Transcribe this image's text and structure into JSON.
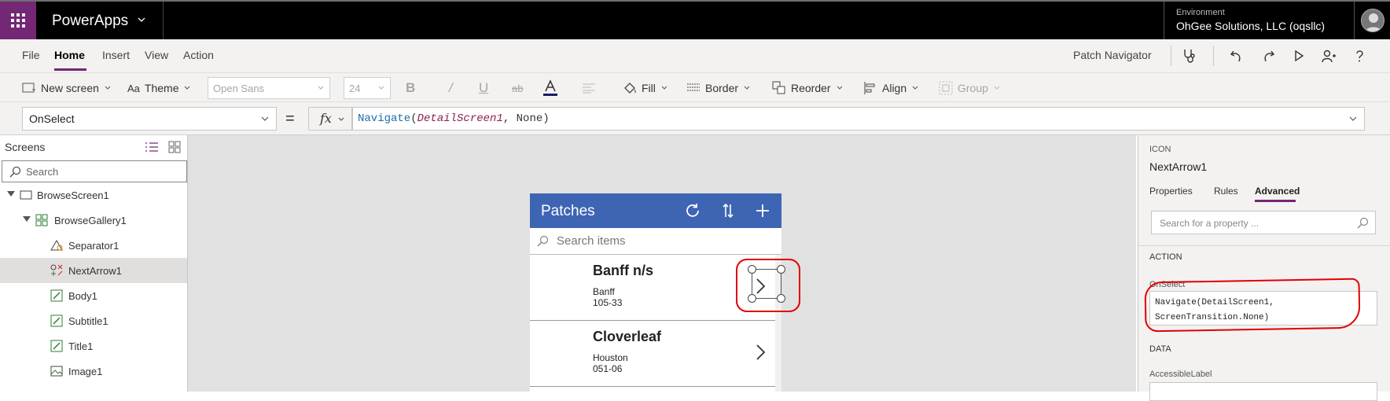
{
  "topbar": {
    "app_name": "PowerApps",
    "environment_label": "Environment",
    "environment_value": "OhGee Solutions, LLC (oqsllc)"
  },
  "menu": {
    "tabs": [
      "File",
      "Home",
      "Insert",
      "View",
      "Action"
    ],
    "active_tab": "Home",
    "screen_name": "Patch Navigator"
  },
  "ribbon": {
    "new_screen": "New screen",
    "theme": "Theme",
    "font_family": "Open Sans",
    "font_size": "24",
    "fill": "Fill",
    "border": "Border",
    "reorder": "Reorder",
    "align": "Align",
    "group": "Group"
  },
  "formula": {
    "property": "OnSelect",
    "equals": "=",
    "fx": "fx",
    "fn_name": "Navigate",
    "open_paren": "(",
    "arg1": "DetailScreen1",
    "rest": ", None)"
  },
  "left_panel": {
    "title": "Screens",
    "search_placeholder": "Search",
    "tree": [
      {
        "label": "BrowseScreen1"
      },
      {
        "label": "BrowseGallery1"
      },
      {
        "label": "Separator1"
      },
      {
        "label": "NextArrow1"
      },
      {
        "label": "Body1"
      },
      {
        "label": "Subtitle1"
      },
      {
        "label": "Title1"
      },
      {
        "label": "Image1"
      }
    ]
  },
  "canvas": {
    "app_title": "Patches",
    "search_placeholder": "Search items",
    "items": [
      {
        "title": "Banff   n/s",
        "subtitle": "Banff",
        "body": "105-33"
      },
      {
        "title": "Cloverleaf",
        "subtitle": "Houston",
        "body": "051-06"
      }
    ]
  },
  "right_panel": {
    "control_kind": "ICON",
    "control_name": "NextArrow1",
    "tabs": [
      "Properties",
      "Rules",
      "Advanced"
    ],
    "active_tab": "Advanced",
    "search_placeholder": "Search for a property ...",
    "section_action": "ACTION",
    "onselect_label": "OnSelect",
    "onselect_line1": "Navigate(DetailScreen1,",
    "onselect_line2": "ScreenTransition.None)",
    "section_data": "DATA",
    "accessible_label": "AccessibleLabel"
  },
  "colors": {
    "brand_purple": "#742774",
    "app_header_blue": "#3e65b3",
    "annotation_red": "#e00000"
  },
  "icons": [
    "waffle-icon",
    "chevron-down-icon",
    "stethoscope-icon",
    "undo-icon",
    "redo-icon",
    "play-icon",
    "share-user-icon",
    "help-icon",
    "refresh-icon",
    "sort-icon",
    "add-icon",
    "search-icon",
    "next-arrow-icon",
    "avatar-icon"
  ]
}
